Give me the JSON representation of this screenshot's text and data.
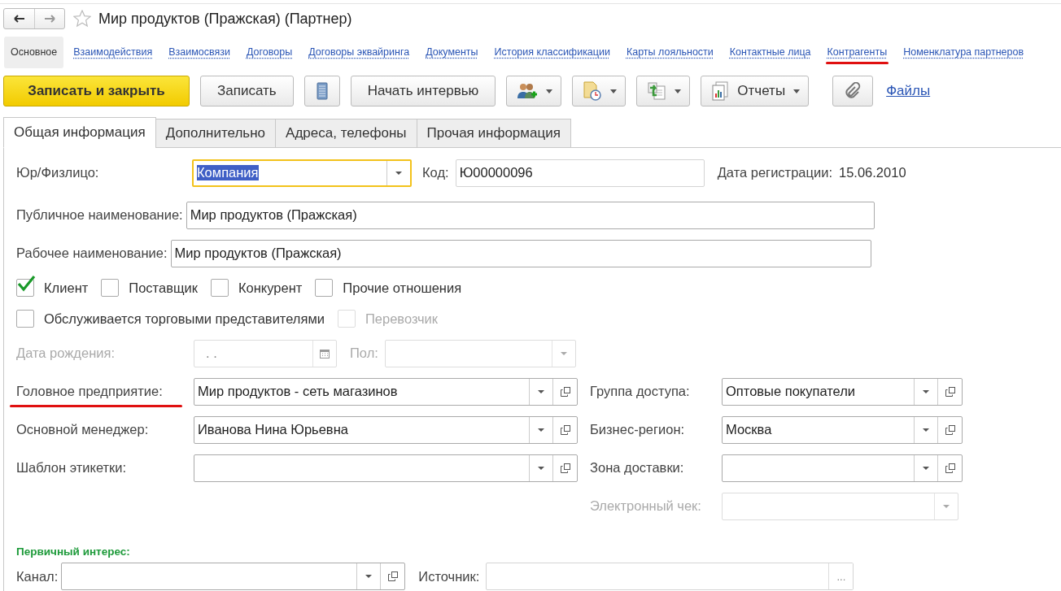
{
  "window": {
    "title": "Мир продуктов (Пражская) (Партнер)",
    "favorite": false
  },
  "nav_links": [
    {
      "label": "Основное",
      "selected": true,
      "marked": false
    },
    {
      "label": "Взаимодействия",
      "selected": false,
      "marked": false
    },
    {
      "label": "Взаимосвязи",
      "selected": false,
      "marked": false
    },
    {
      "label": "Договоры",
      "selected": false,
      "marked": false
    },
    {
      "label": "Договоры эквайринга",
      "selected": false,
      "marked": false
    },
    {
      "label": "Документы",
      "selected": false,
      "marked": false
    },
    {
      "label": "История классификации",
      "selected": false,
      "marked": false
    },
    {
      "label": "Карты лояльности",
      "selected": false,
      "marked": false
    },
    {
      "label": "Контактные лица",
      "selected": false,
      "marked": false
    },
    {
      "label": "Контрагенты",
      "selected": false,
      "marked": true
    },
    {
      "label": "Номенклатура партнеров",
      "selected": false,
      "marked": false
    }
  ],
  "toolbar": [
    {
      "kind": "primary",
      "label": "Записать и закрыть"
    },
    {
      "kind": "text",
      "label": "Записать"
    },
    {
      "kind": "icon"
    },
    {
      "kind": "text",
      "label": "Начать интервью"
    },
    {
      "kind": "icon-menu"
    },
    {
      "kind": "icon-menu"
    },
    {
      "kind": "icon-menu"
    },
    {
      "kind": "text-menu",
      "label": "Отчеты"
    },
    {
      "kind": "icon"
    },
    {
      "kind": "link",
      "label": "Файлы"
    }
  ],
  "tabs": [
    {
      "label": "Общая информация",
      "selected": true
    },
    {
      "label": "Дополнительно",
      "selected": false
    },
    {
      "label": "Адреса, телефоны",
      "selected": false
    },
    {
      "label": "Прочая информация",
      "selected": false
    }
  ],
  "legal_form": {
    "label": "Юр/Физлицо:",
    "value": "Компания",
    "focused": true
  },
  "code": {
    "label": "Код:",
    "value": "Ю00000096"
  },
  "registration_date": {
    "label": "Дата регистрации:",
    "value": "15.06.2010"
  },
  "public_name": {
    "label": "Публичное наименование:",
    "value": "Мир продуктов (Пражская)"
  },
  "working_name": {
    "label": "Рабочее наименование:",
    "value": "Мир продуктов (Пражская)"
  },
  "checkbox_rows": [
    [
      {
        "label": "Клиент",
        "checked": true,
        "disabled": false
      },
      {
        "label": "Поставщик",
        "checked": false,
        "disabled": false
      },
      {
        "label": "Конкурент",
        "checked": false,
        "disabled": false
      },
      {
        "label": "Прочие отношения",
        "checked": false,
        "disabled": false
      }
    ],
    [
      {
        "label": "Обслуживается торговыми представителями",
        "checked": false,
        "disabled": false
      },
      {
        "label": "Перевозчик",
        "checked": false,
        "disabled": true
      }
    ]
  ],
  "birth_date": {
    "label": "Дата рождения:",
    "placeholder": ". .",
    "disabled": true
  },
  "gender": {
    "label": "Пол:",
    "disabled": true
  },
  "left_fields": [
    {
      "label": "Головное предприятие:",
      "value": "Мир продуктов - сеть магазинов",
      "marked": true
    },
    {
      "label": "Основной менеджер:",
      "value": "Иванова Нина Юрьевна",
      "marked": false
    },
    {
      "label": "Шаблон этикетки:",
      "marked": false
    }
  ],
  "right_fields": [
    {
      "label": "Группа доступа:",
      "value": "Оптовые покупатели",
      "disabled": false
    },
    {
      "label": "Бизнес-регион:",
      "value": "Москва",
      "disabled": false
    },
    {
      "label": "Зона доставки:",
      "disabled": false
    },
    {
      "label": "Электронный чек:",
      "disabled": true
    }
  ],
  "primary_interest": {
    "title": "Первичный интерес:",
    "channel": {
      "label": "Канал:"
    },
    "source": {
      "label": "Источник:",
      "button": "..."
    }
  }
}
